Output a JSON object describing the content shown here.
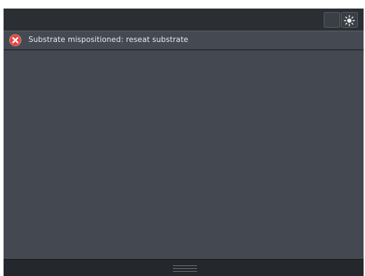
{
  "topbar": {
    "buttons": [
      {
        "icon": "blank-icon"
      },
      {
        "icon": "brightness-icon"
      }
    ]
  },
  "alert": {
    "severity": "error",
    "icon": "error-x-icon",
    "message": "Substrate mispositioned: reseat substrate",
    "colors": {
      "icon_bg": "#e8453c",
      "text": "#e8eaed"
    }
  },
  "bottombar": {
    "handle_icon": "drag-handle-icon"
  },
  "colors": {
    "background": "#3e434a",
    "topbar": "#2b2f34",
    "content": "#444951",
    "bottombar": "#24272b"
  }
}
